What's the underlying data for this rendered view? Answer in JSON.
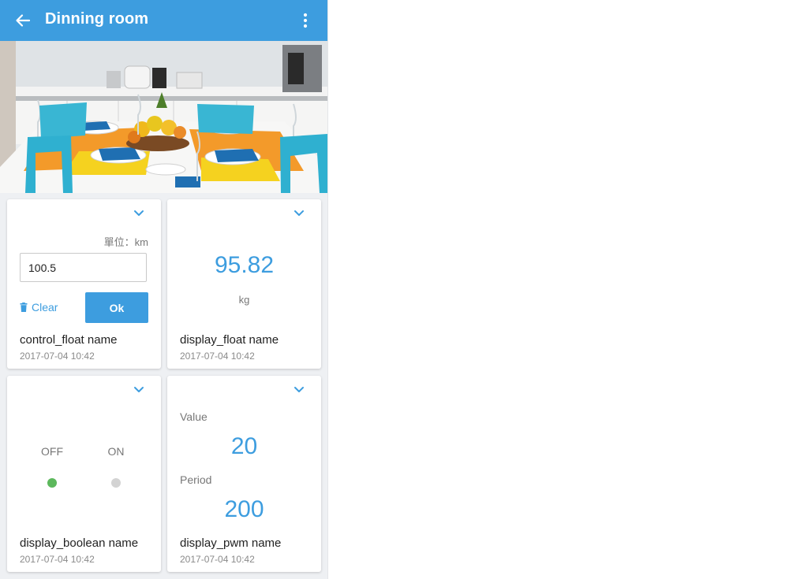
{
  "header": {
    "title": "Dinning room",
    "bar_color": "#3d9ddf",
    "back_icon": "arrow-left-icon",
    "menu_icon": "more-vertical-icon"
  },
  "photo": {
    "subject": "room-photo"
  },
  "cards": {
    "control_float": {
      "unit_label": "單位：km",
      "input_value": "100.5",
      "clear_label": "Clear",
      "ok_label": "Ok",
      "name": "control_float name",
      "timestamp": "2017-07-04 10:42"
    },
    "display_float": {
      "value": "95.82",
      "unit": "kg",
      "name": "display_float name",
      "timestamp": "2017-07-04 10:42"
    },
    "display_boolean": {
      "off_label": "OFF",
      "on_label": "ON",
      "off_color": "#5cb85c",
      "on_color": "#d3d3d3",
      "name": "display_boolean name",
      "timestamp": "2017-07-04 10:42"
    },
    "display_pwm": {
      "value_label": "Value",
      "value": "20",
      "period_label": "Period",
      "period": "200",
      "name": "display_pwm name",
      "timestamp": "2017-07-04 10:42"
    }
  },
  "accent_color": "#3d9ddf"
}
